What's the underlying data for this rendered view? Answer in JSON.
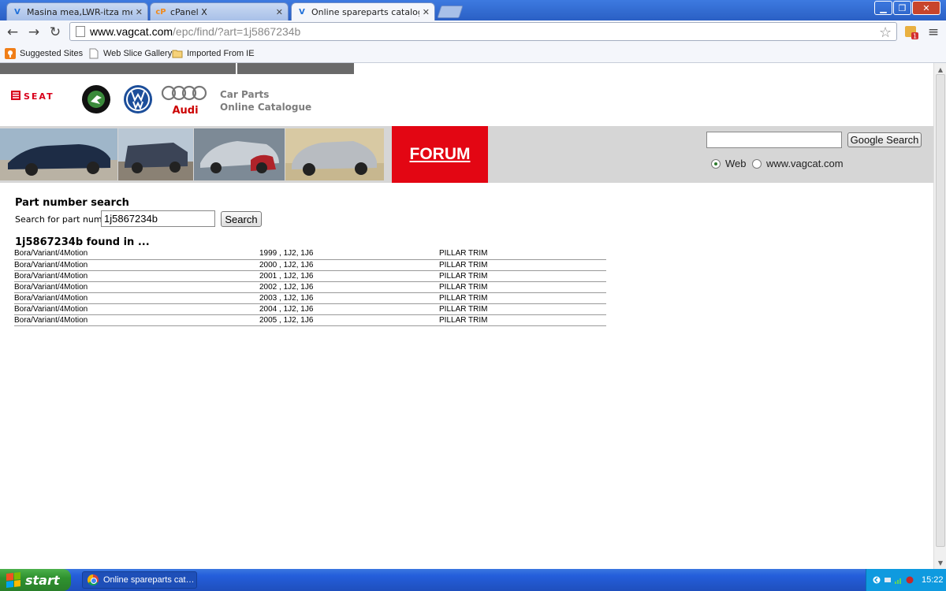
{
  "browser": {
    "tabs": [
      {
        "label": "Masina mea,LWR-itza mea - |",
        "favicon": "vagcat-favicon",
        "active": false
      },
      {
        "label": "cPanel X",
        "favicon": "cpanel-favicon",
        "active": false
      },
      {
        "label": "Online spareparts catalogue",
        "favicon": "vagcat-favicon",
        "active": true
      }
    ],
    "url_host": "www.vagcat.com",
    "url_path": "/epc/find/?art=1j5867234b",
    "bookmarks": [
      "Suggested Sites",
      "Web Slice Gallery",
      "Imported From IE"
    ]
  },
  "site": {
    "brand_title_line1": "Car Parts",
    "brand_title_line2": "Online Catalogue",
    "logos": {
      "seat": "SEAT",
      "audi": "Audi"
    },
    "forum_label": "FORUM",
    "google_search": {
      "button_label": "Google Search",
      "input_value": "",
      "radio_options": [
        {
          "label": "Web",
          "checked": true
        },
        {
          "label": "www.vagcat.com",
          "checked": false
        }
      ]
    }
  },
  "search": {
    "heading": "Part number search",
    "label": "Search for part number",
    "value": "1j5867234b",
    "button_label": "Search"
  },
  "results": {
    "heading": "1j5867234b found in ...",
    "rows": [
      {
        "model": "Bora/Variant/4Motion",
        "year_codes": "1999 , 1J2, 1J6",
        "part": "PILLAR TRIM"
      },
      {
        "model": "Bora/Variant/4Motion",
        "year_codes": "2000 , 1J2, 1J6",
        "part": "PILLAR TRIM"
      },
      {
        "model": "Bora/Variant/4Motion",
        "year_codes": "2001 , 1J2, 1J6",
        "part": "PILLAR TRIM"
      },
      {
        "model": "Bora/Variant/4Motion",
        "year_codes": "2002 , 1J2, 1J6",
        "part": "PILLAR TRIM"
      },
      {
        "model": "Bora/Variant/4Motion",
        "year_codes": "2003 , 1J2, 1J6",
        "part": "PILLAR TRIM"
      },
      {
        "model": "Bora/Variant/4Motion",
        "year_codes": "2004 , 1J2, 1J6",
        "part": "PILLAR TRIM"
      },
      {
        "model": "Bora/Variant/4Motion",
        "year_codes": "2005 , 1J2, 1J6",
        "part": "PILLAR TRIM"
      }
    ]
  },
  "taskbar": {
    "start_label": "start",
    "task_label": "Online spareparts cat…",
    "clock": "15:22"
  },
  "colors": {
    "forum_red": "#e30613",
    "banner_gray": "#d6d6d6",
    "title_gray": "#7d7d7d"
  }
}
